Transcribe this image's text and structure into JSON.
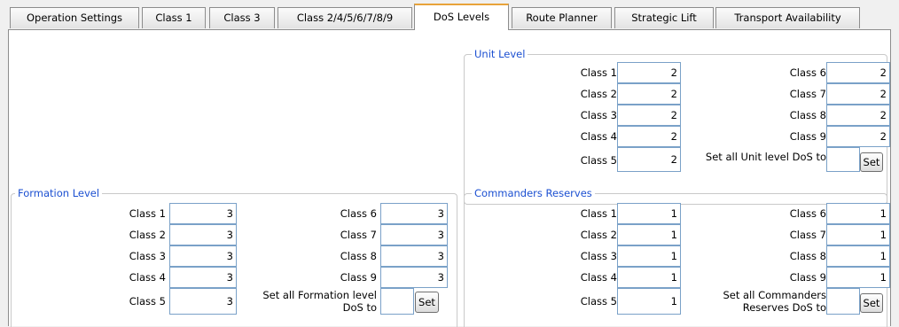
{
  "tabs": [
    {
      "label": "Operation Settings"
    },
    {
      "label": "Class 1"
    },
    {
      "label": "Class 3"
    },
    {
      "label": "Class 2/4/5/6/7/8/9"
    },
    {
      "label": "DoS Levels"
    },
    {
      "label": "Route Planner"
    },
    {
      "label": "Strategic Lift"
    },
    {
      "label": "Transport Availability"
    }
  ],
  "active_tab": "DoS Levels",
  "unit_level": {
    "title": "Unit Level",
    "rows": [
      {
        "label": "Class 1",
        "value": "2"
      },
      {
        "label": "Class 2",
        "value": "2"
      },
      {
        "label": "Class 3",
        "value": "2"
      },
      {
        "label": "Class 4",
        "value": "2"
      },
      {
        "label": "Class 5",
        "value": "2"
      },
      {
        "label": "Class 6",
        "value": "2"
      },
      {
        "label": "Class 7",
        "value": "2"
      },
      {
        "label": "Class 8",
        "value": "2"
      },
      {
        "label": "Class 9",
        "value": "2"
      }
    ],
    "set_all_label": "Set all Unit level DoS to",
    "set_value": "",
    "set_button": "Set"
  },
  "formation_level": {
    "title": "Formation Level",
    "rows": [
      {
        "label": "Class 1",
        "value": "3"
      },
      {
        "label": "Class 2",
        "value": "3"
      },
      {
        "label": "Class 3",
        "value": "3"
      },
      {
        "label": "Class 4",
        "value": "3"
      },
      {
        "label": "Class 5",
        "value": "3"
      },
      {
        "label": "Class 6",
        "value": "3"
      },
      {
        "label": "Class 7",
        "value": "3"
      },
      {
        "label": "Class 8",
        "value": "3"
      },
      {
        "label": "Class 9",
        "value": "3"
      }
    ],
    "set_all_label_line1": "Set all Formation level",
    "set_all_label_line2": "DoS to",
    "set_value": "",
    "set_button": "Set"
  },
  "commanders_reserves": {
    "title": "Commanders Reserves",
    "rows": [
      {
        "label": "Class 1",
        "value": "1"
      },
      {
        "label": "Class 2",
        "value": "1"
      },
      {
        "label": "Class 3",
        "value": "1"
      },
      {
        "label": "Class 4",
        "value": "1"
      },
      {
        "label": "Class 5",
        "value": "1"
      },
      {
        "label": "Class 6",
        "value": "1"
      },
      {
        "label": "Class 7",
        "value": "1"
      },
      {
        "label": "Class 8",
        "value": "1"
      },
      {
        "label": "Class 9",
        "value": "1"
      }
    ],
    "set_all_label_line1": "Set all Commanders",
    "set_all_label_line2": "Reserves DoS to",
    "set_value": "",
    "set_button": "Set"
  },
  "colors": {
    "group_title": "#1b4fd1",
    "active_tab_accent": "#e8a33a",
    "field_border": "#7aa1c8"
  }
}
